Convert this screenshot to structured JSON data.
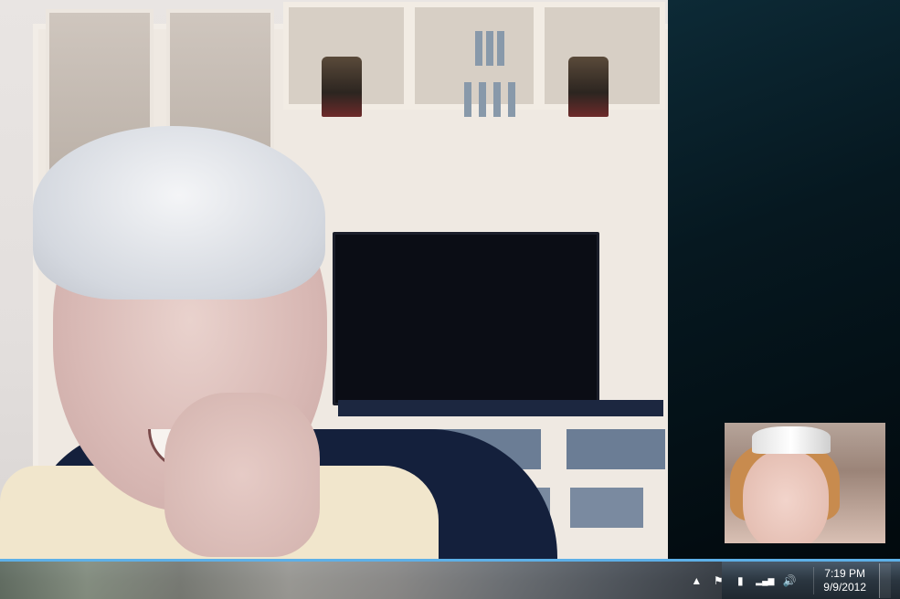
{
  "window": {
    "type": "video-call"
  },
  "taskbar": {
    "tray_icons": [
      {
        "name": "show-hidden-icons",
        "glyph": "▲"
      },
      {
        "name": "action-center-flag-icon",
        "glyph": "⚑"
      },
      {
        "name": "battery-icon",
        "glyph": "▮"
      },
      {
        "name": "network-signal-icon",
        "glyph": "▂▄▆"
      },
      {
        "name": "volume-icon",
        "glyph": "🔊"
      }
    ],
    "clock": {
      "time": "7:19 PM",
      "date": "9/9/2012"
    }
  },
  "colors": {
    "taskbar_accent": "#5db0e8",
    "panel_dark": "#061820"
  }
}
